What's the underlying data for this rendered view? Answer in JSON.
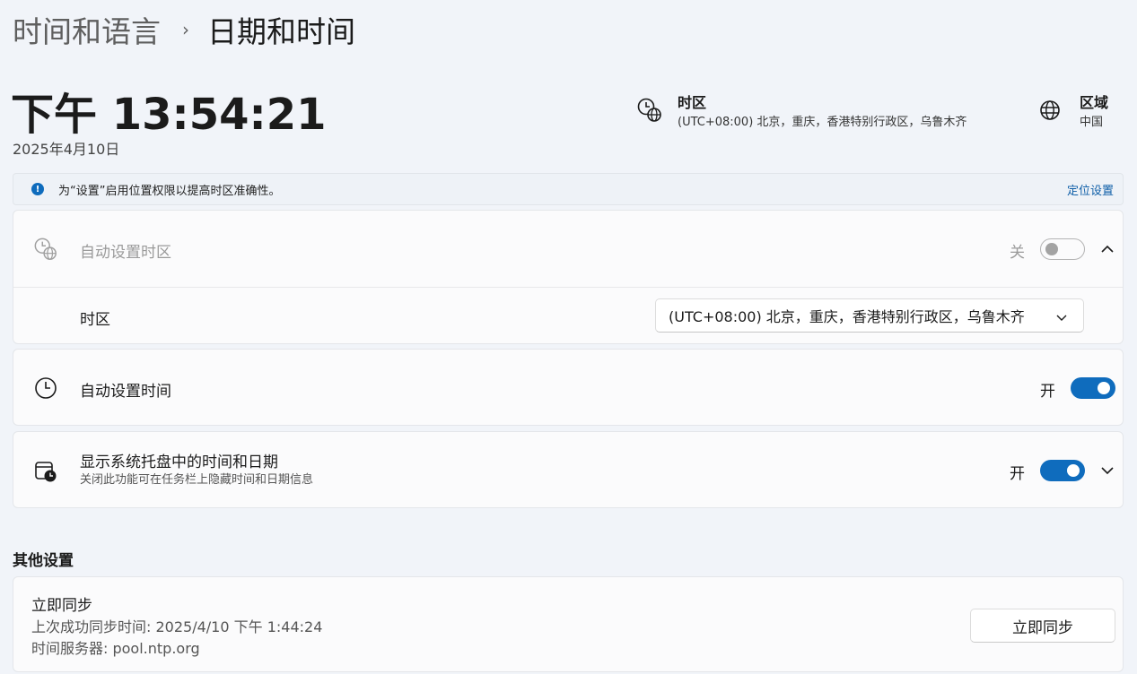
{
  "breadcrumb": {
    "parent": "时间和语言",
    "separator": "›",
    "current": "日期和时间"
  },
  "clock": {
    "time": "下午 13:54:21",
    "date": "2025年4月10日"
  },
  "timezone_info": {
    "title": "时区",
    "value": "(UTC+08:00) 北京，重庆，香港特别行政区，乌鲁木齐"
  },
  "region_info": {
    "title": "区域",
    "value": "中国"
  },
  "notice": {
    "text": "为“设置”启用位置权限以提高时区准确性。",
    "link": "定位设置",
    "icon": "info-icon"
  },
  "auto_timezone": {
    "label": "自动设置时区",
    "state": "关",
    "enabled": false
  },
  "timezone_select": {
    "label": "时区",
    "value": "(UTC+08:00) 北京，重庆，香港特别行政区，乌鲁木齐"
  },
  "auto_time": {
    "label": "自动设置时间",
    "state": "开",
    "enabled": true
  },
  "tray_time": {
    "label": "显示系统托盘中的时间和日期",
    "sub": "关闭此功能可在任务栏上隐藏时间和日期信息",
    "state": "开",
    "enabled": true
  },
  "other_settings": {
    "title": "其他设置",
    "sync": {
      "title": "立即同步",
      "last_sync": "上次成功同步时间: 2025/4/10 下午 1:44:24",
      "server": "时间服务器: pool.ntp.org",
      "button": "立即同步"
    }
  },
  "colors": {
    "accent": "#0f6cbd",
    "background": "#f1f4f9",
    "card": "#fbfbfc"
  }
}
